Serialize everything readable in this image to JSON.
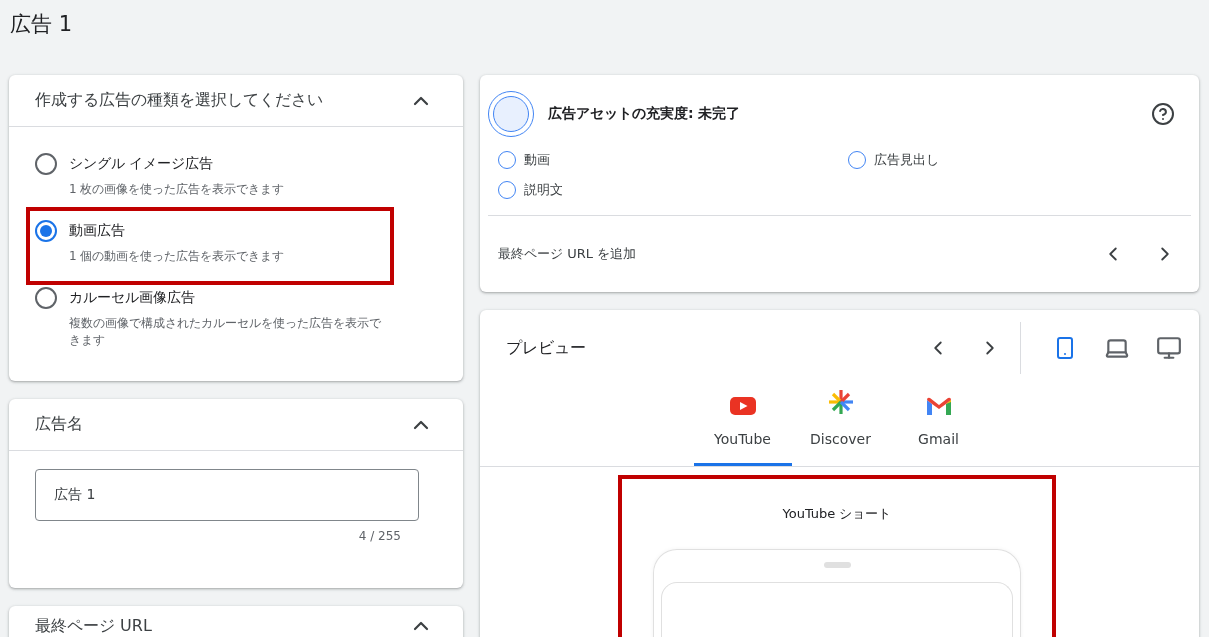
{
  "page_title": "広告 1",
  "ad_type_card": {
    "title": "作成する広告の種類を選択してください",
    "expanded": true,
    "options": [
      {
        "label": "シングル イメージ広告",
        "description": "1 枚の画像を使った広告を表示できます",
        "selected": false,
        "highlighted": false
      },
      {
        "label": "動画広告",
        "description": "1 個の動画を使った広告を表示できます",
        "selected": true,
        "highlighted": true
      },
      {
        "label": "カルーセル画像広告",
        "description": "複数の画像で構成されたカルーセルを使った広告を表示できます",
        "selected": false,
        "highlighted": false
      }
    ]
  },
  "ad_name_card": {
    "title": "広告名",
    "expanded": true,
    "value": "広告 1",
    "counter": "4 / 255"
  },
  "final_url_card": {
    "title": "最終ページ URL",
    "expanded": true
  },
  "asset_strength": {
    "title": "広告アセットの充実度: 未完了",
    "items": [
      {
        "label": "動画",
        "done": false
      },
      {
        "label": "広告見出し",
        "done": false
      },
      {
        "label": "説明文",
        "done": false
      }
    ],
    "suggestion": "最終ページ URL を追加"
  },
  "preview": {
    "title": "プレビュー",
    "devices": [
      {
        "kind": "mobile",
        "selected": true
      },
      {
        "kind": "laptop",
        "selected": false
      },
      {
        "kind": "desktop",
        "selected": false
      }
    ],
    "tabs": [
      {
        "kind": "youtube",
        "label": "YouTube",
        "selected": true
      },
      {
        "kind": "discover",
        "label": "Discover",
        "selected": false
      },
      {
        "kind": "gmail",
        "label": "Gmail",
        "selected": false
      }
    ],
    "format_label": "YouTube ショート",
    "highlighted": true
  }
}
